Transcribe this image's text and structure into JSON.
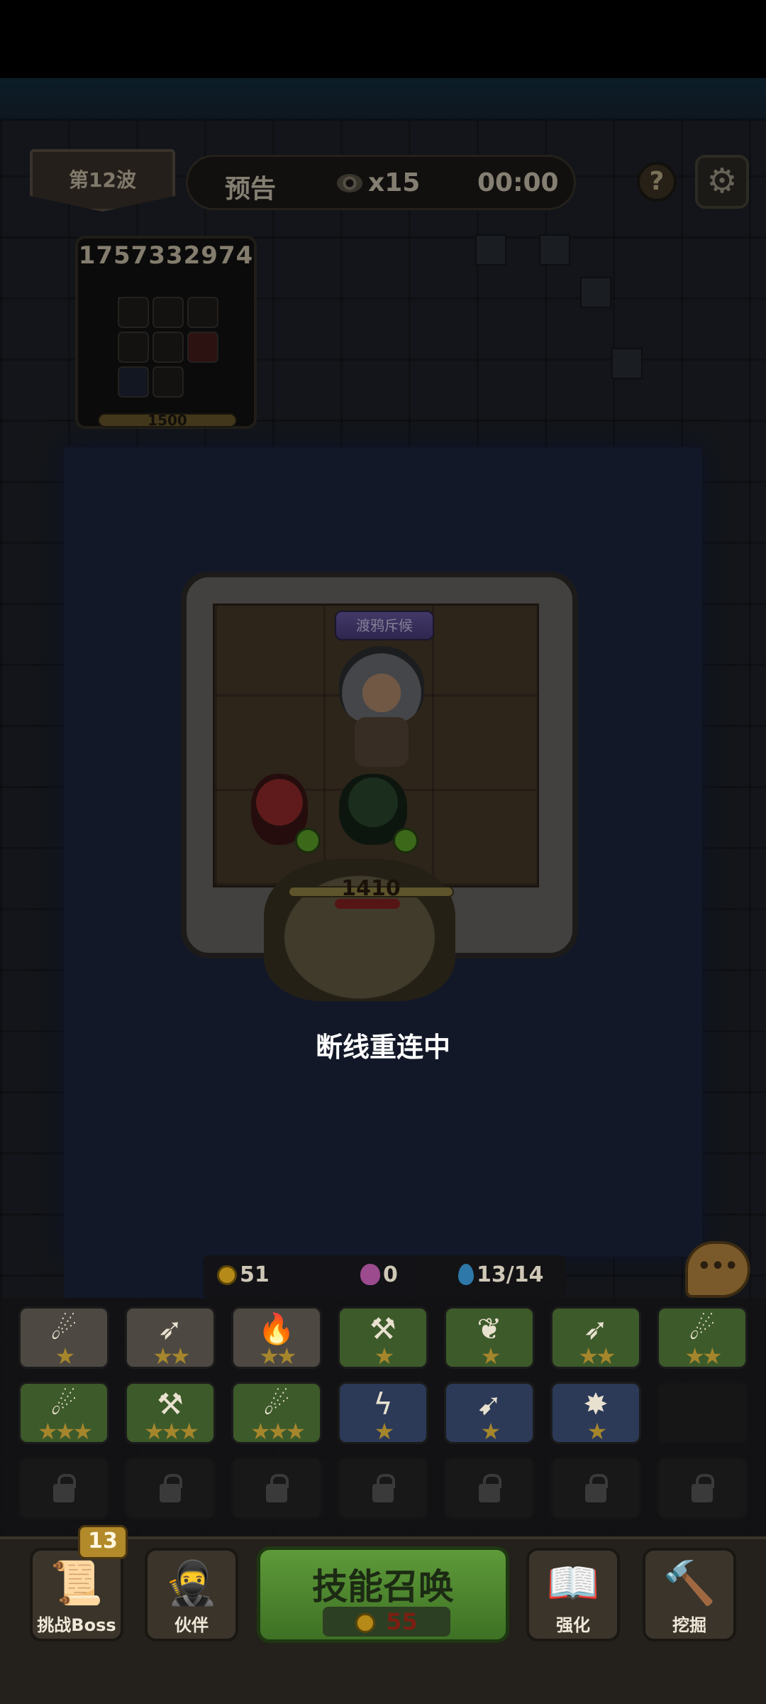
{
  "top_bar": {
    "wave_label": "第12波",
    "notice_label": "预告",
    "enemy_count": "x15",
    "timer": "00:00",
    "help_label": "?"
  },
  "opponent": {
    "id": "1757332974",
    "hp": "1500"
  },
  "arena": {
    "unit_title": "渡鸦斥候",
    "enemy_hp": "1410",
    "status_text": "断线重连中"
  },
  "resources": {
    "coins": "51",
    "gems": "0",
    "mana": "13/14"
  },
  "skill_slots": [
    {
      "icon": "frost-bolt-icon",
      "stars": "★",
      "tier": "gray"
    },
    {
      "icon": "arrow-volley-icon",
      "stars": "★★",
      "tier": "gray"
    },
    {
      "icon": "fire-bolt-icon",
      "stars": "★★",
      "tier": "gray"
    },
    {
      "icon": "golden-hammer-icon",
      "stars": "★",
      "tier": "green"
    },
    {
      "icon": "vine-icon",
      "stars": "★",
      "tier": "green"
    },
    {
      "icon": "arrow-volley-icon",
      "stars": "★★",
      "tier": "green"
    },
    {
      "icon": "frost-bolt-icon",
      "stars": "★★",
      "tier": "green"
    },
    {
      "icon": "frost-bolt-icon",
      "stars": "★★★",
      "tier": "green"
    },
    {
      "icon": "golden-hammer-icon",
      "stars": "★★★",
      "tier": "green"
    },
    {
      "icon": "frost-bolt-icon",
      "stars": "★★★",
      "tier": "green"
    },
    {
      "icon": "lightning-icon",
      "stars": "★",
      "tier": "blue"
    },
    {
      "icon": "spear-icon",
      "stars": "★",
      "tier": "blue"
    },
    {
      "icon": "blood-burst-icon",
      "stars": "★",
      "tier": "blue"
    }
  ],
  "nav": {
    "boss_badge": "13",
    "boss_label": "挑战Boss",
    "partner_label": "伙伴",
    "summon_label": "技能召唤",
    "summon_cost": "55",
    "upgrade_label": "强化",
    "dig_label": "挖掘"
  },
  "colors": {
    "summon_green": "#5e9a3a",
    "coin_gold": "#b58a18",
    "tier_blue": "#2c3a58",
    "tier_green": "#3d5a2a"
  }
}
